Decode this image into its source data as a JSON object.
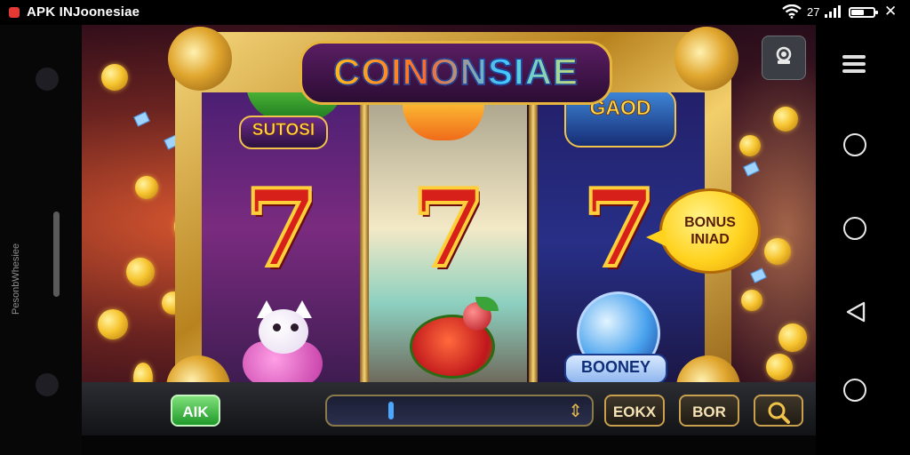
{
  "status_bar": {
    "app_title": "APK INJoonesiae",
    "signal_text": "27",
    "battery_level": 0.6,
    "close_glyph": "✕"
  },
  "left_rail": {
    "vertical_text": "PesonbWhesiee"
  },
  "game": {
    "logo_text": "COINONSIAE",
    "reels": {
      "reel1_badge": "SUTOSI",
      "reel3_badge": "GAOD",
      "reel3_orb_label": "BOONEY",
      "seven_symbol": "7"
    },
    "bonus_badge": {
      "line1": "BONUS",
      "line2": "INIAD"
    },
    "bottom_bar": {
      "left_button": "AIK",
      "bet_slider_level": 0.25,
      "slider_arrows": "⇕",
      "button_1": "EOKX",
      "button_2": "BOR"
    },
    "icons": [
      "camera-icon",
      "search-icon"
    ]
  },
  "nav": {
    "items": [
      "menu-icon",
      "home-circle-icon",
      "recents-circle-icon",
      "back-triangle-icon",
      "assist-circle-icon"
    ]
  },
  "colors": {
    "frame_gold": "#d9a53a",
    "seven_red": "#d8201b",
    "bonus_yellow": "#ffd21e",
    "accent_green": "#1f9a2a"
  }
}
